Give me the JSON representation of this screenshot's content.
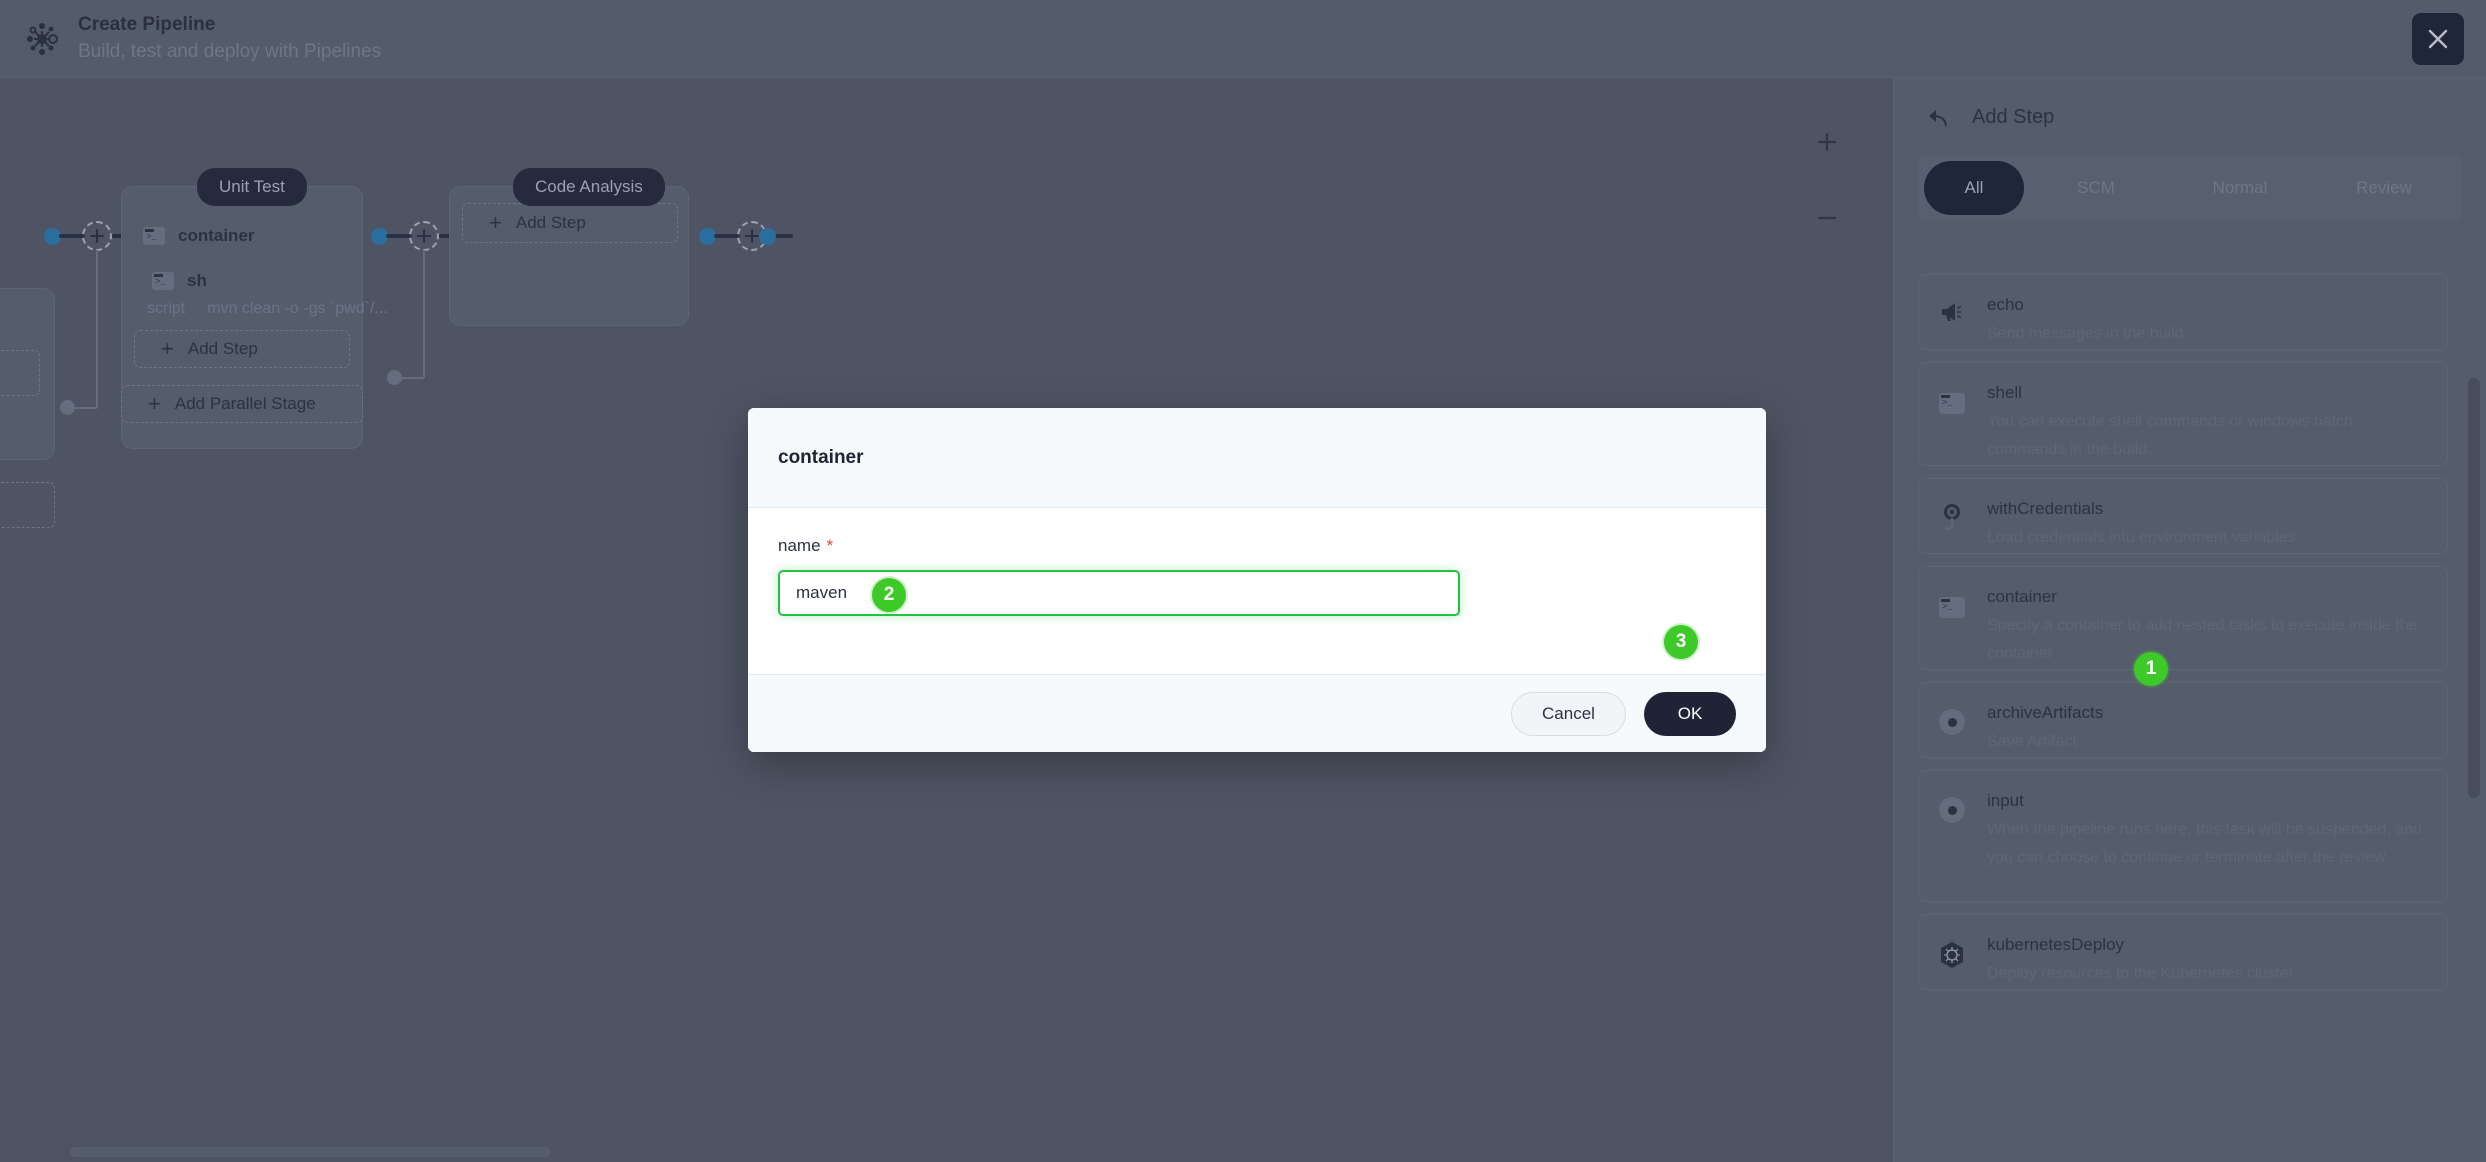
{
  "header": {
    "title": "Create Pipeline",
    "subtitle": "Build, test and deploy with Pipelines",
    "logo_icon": "pipeline-logo-icon",
    "close_icon": "close-icon"
  },
  "canvas": {
    "zoom_in_label": "+",
    "zoom_out_label": "–",
    "stages": [
      {
        "label": "Unit Test",
        "steps": [
          {
            "name": "container",
            "icon": "terminal-icon"
          },
          {
            "name": "sh",
            "icon": "terminal-icon"
          }
        ],
        "script_key": "script",
        "script_value": "mvn clean -o -gs `pwd`/...",
        "add_step_label": "Add Step"
      },
      {
        "label": "Code Analysis",
        "add_step_label": "Add Step"
      }
    ],
    "add_parallel_stage_label": "Add Parallel Stage",
    "plus_node_label": "+"
  },
  "panel": {
    "back_icon": "back-arrow-icon",
    "title": "Add Step",
    "tabs": [
      {
        "label": "All",
        "active": true
      },
      {
        "label": "SCM",
        "active": false
      },
      {
        "label": "Normal",
        "active": false
      },
      {
        "label": "Review",
        "active": false
      }
    ],
    "steps": [
      {
        "name": "echo",
        "desc": "Send messages in the build",
        "icon": "megaphone-icon"
      },
      {
        "name": "shell",
        "desc": "You can execute shell commands or windows batch commands in the build.",
        "icon": "terminal-icon"
      },
      {
        "name": "withCredentials",
        "desc": "Load credentials into environment variables",
        "icon": "key-icon"
      },
      {
        "name": "container",
        "desc": "Specify a container to add nested tasks to execute inside the container",
        "icon": "terminal-icon"
      },
      {
        "name": "archiveArtifacts",
        "desc": "Save Artifact",
        "icon": "record-icon"
      },
      {
        "name": "input",
        "desc": "When the pipeline runs here, this task will be suspended, and you can choose to continue or terminate after the review.",
        "icon": "record-icon"
      },
      {
        "name": "kubernetesDeploy",
        "desc": "Deploy resources to the Kubernetes cluster",
        "icon": "kubernetes-icon"
      }
    ]
  },
  "modal": {
    "title": "container",
    "field_label": "name",
    "required_marker": "*",
    "input_value": "maven",
    "input_placeholder": "",
    "cancel_label": "Cancel",
    "ok_label": "OK"
  },
  "annotations": {
    "badge_1": "1",
    "badge_2": "2",
    "badge_3": "3"
  },
  "colors": {
    "accent_green": "#3dc928",
    "dark_button": "#1e2436",
    "node_blue": "#2a6ea0",
    "required_red": "#e8453c"
  }
}
